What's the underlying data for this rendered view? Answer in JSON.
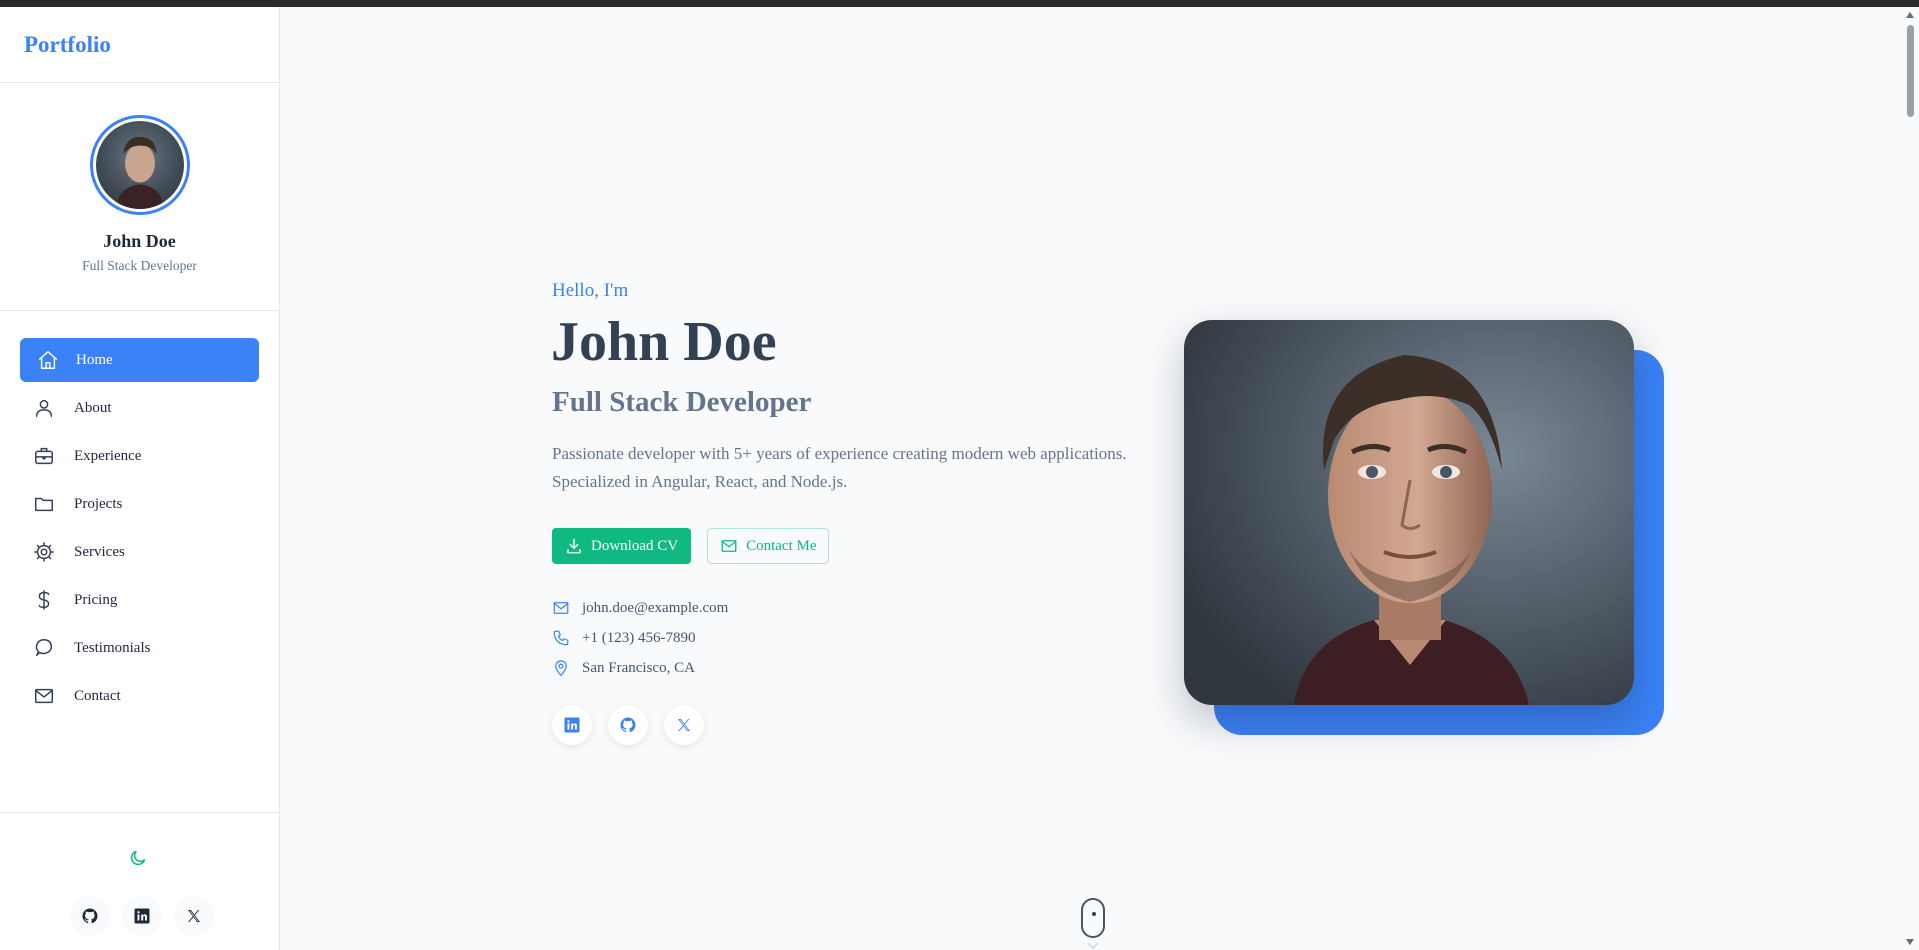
{
  "sidebar": {
    "brand": "Portfolio",
    "profile": {
      "name": "John Doe",
      "role": "Full Stack Developer"
    },
    "nav": [
      {
        "label": "Home",
        "icon": "home-icon",
        "active": true
      },
      {
        "label": "About",
        "icon": "user-icon"
      },
      {
        "label": "Experience",
        "icon": "briefcase-icon"
      },
      {
        "label": "Projects",
        "icon": "folder-icon"
      },
      {
        "label": "Services",
        "icon": "gear-icon"
      },
      {
        "label": "Pricing",
        "icon": "dollar-icon"
      },
      {
        "label": "Testimonials",
        "icon": "chat-icon"
      },
      {
        "label": "Contact",
        "icon": "mail-icon"
      }
    ],
    "footer": {
      "theme_icon": "moon-icon",
      "socials": [
        "github-icon",
        "linkedin-icon",
        "x-icon"
      ]
    }
  },
  "hero": {
    "greeting": "Hello, I'm",
    "name": "John Doe",
    "role": "Full Stack Developer",
    "description": "Passionate developer with 5+ years of experience creating modern web applications. Specialized in Angular, React, and Node.js.",
    "buttons": {
      "download": "Download CV",
      "contact": "Contact Me"
    },
    "contacts": {
      "email": "john.doe@example.com",
      "phone": "+1 (123) 456-7890",
      "location": "San Francisco, CA"
    },
    "socials": [
      "linkedin-icon",
      "github-icon",
      "x-icon"
    ]
  },
  "colors": {
    "accent": "#3b82f6",
    "success": "#10b981",
    "text": "#334155",
    "muted": "#64748b",
    "background": "#f8fafc"
  }
}
